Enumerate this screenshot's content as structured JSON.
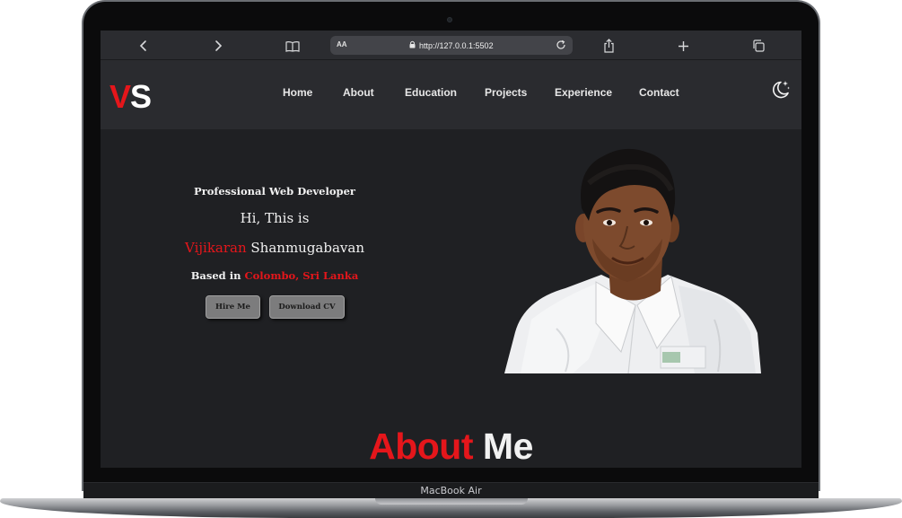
{
  "device": {
    "label": "MacBook Air"
  },
  "browser": {
    "text_size_label": "AA",
    "url": "http://127.0.0.1:5502",
    "icons": {
      "back": "chevron-left-icon",
      "forward": "chevron-right-icon",
      "reader": "book-icon",
      "lock": "lock-icon",
      "reload": "reload-icon",
      "share": "share-icon",
      "new_tab": "plus-icon",
      "tabs": "tabs-icon"
    }
  },
  "site": {
    "logo": {
      "first": "V",
      "second": "S"
    },
    "nav": [
      "Home",
      "About",
      "Education",
      "Projects",
      "Experience",
      "Contact"
    ],
    "theme_icon": "moon-stars-icon",
    "colors": {
      "accent": "#e5161b",
      "background": "#1f2023",
      "header": "#2a2b2f",
      "button": "#7c7c7d"
    }
  },
  "hero": {
    "subtitle": "Professional Web Developer",
    "greeting": "Hi, This is",
    "first_name": "Vijikaran",
    "last_name": "Shanmugabavan",
    "location_prefix": "Based in",
    "location": "Colombo, Sri Lanka",
    "buttons": {
      "hire": "Hire Me",
      "cv": "Download CV"
    }
  },
  "about": {
    "title_first": "About",
    "title_second": "Me"
  }
}
